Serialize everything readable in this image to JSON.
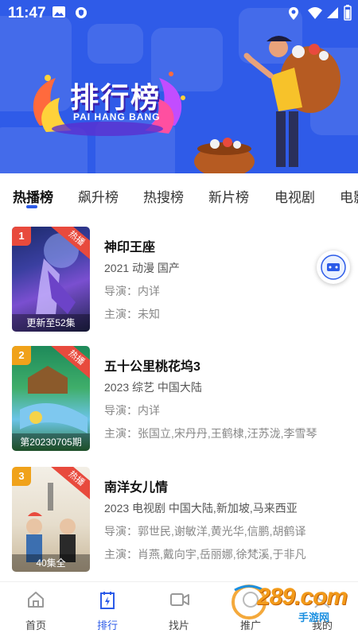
{
  "status_bar": {
    "time": "11:47"
  },
  "hero": {
    "title": "排行榜",
    "subtitle": "PAI HANG BANG"
  },
  "tabs": [
    {
      "label": "热播榜",
      "active": true
    },
    {
      "label": "飙升榜"
    },
    {
      "label": "热搜榜"
    },
    {
      "label": "新片榜"
    },
    {
      "label": "电视剧"
    },
    {
      "label": "电影"
    }
  ],
  "items": [
    {
      "rank": "1",
      "badge": "热播",
      "poster_caption": "更新至52集",
      "title": "神印王座",
      "meta": "2021  动漫  国产",
      "director": "导演：内详",
      "cast": "主演：未知"
    },
    {
      "rank": "2",
      "badge": "热播",
      "poster_caption": "第20230705期",
      "title": "五十公里桃花坞3",
      "meta": "2023  综艺  中国大陆",
      "director": "导演：内详",
      "cast": "主演：张国立,宋丹丹,王鹤棣,汪苏泷,李雪琴"
    },
    {
      "rank": "3",
      "badge": "热播",
      "poster_caption": "40集全",
      "title": "南洋女儿情",
      "meta": "2023  电视剧  中国大陆,新加坡,马来西亚",
      "director": "导演：郭世民,谢敏洋,黄光华,信鹏,胡鹤译",
      "cast": "主演：肖燕,戴向宇,岳丽娜,徐梵溪,于非凡"
    }
  ],
  "bottom_nav": [
    {
      "label": "首页",
      "icon": "home-icon"
    },
    {
      "label": "排行",
      "icon": "ranking-icon",
      "active": true
    },
    {
      "label": "找片",
      "icon": "video-camera-icon"
    },
    {
      "label": "推广",
      "icon": "promote-icon"
    },
    {
      "label": "我的",
      "icon": "profile-icon"
    }
  ],
  "watermark": {
    "text": "289.com",
    "sub": "手游网"
  },
  "colors": {
    "hero_bg": "#2f5be8",
    "accent": "#2c5be8",
    "badge": "#e84a3d"
  }
}
